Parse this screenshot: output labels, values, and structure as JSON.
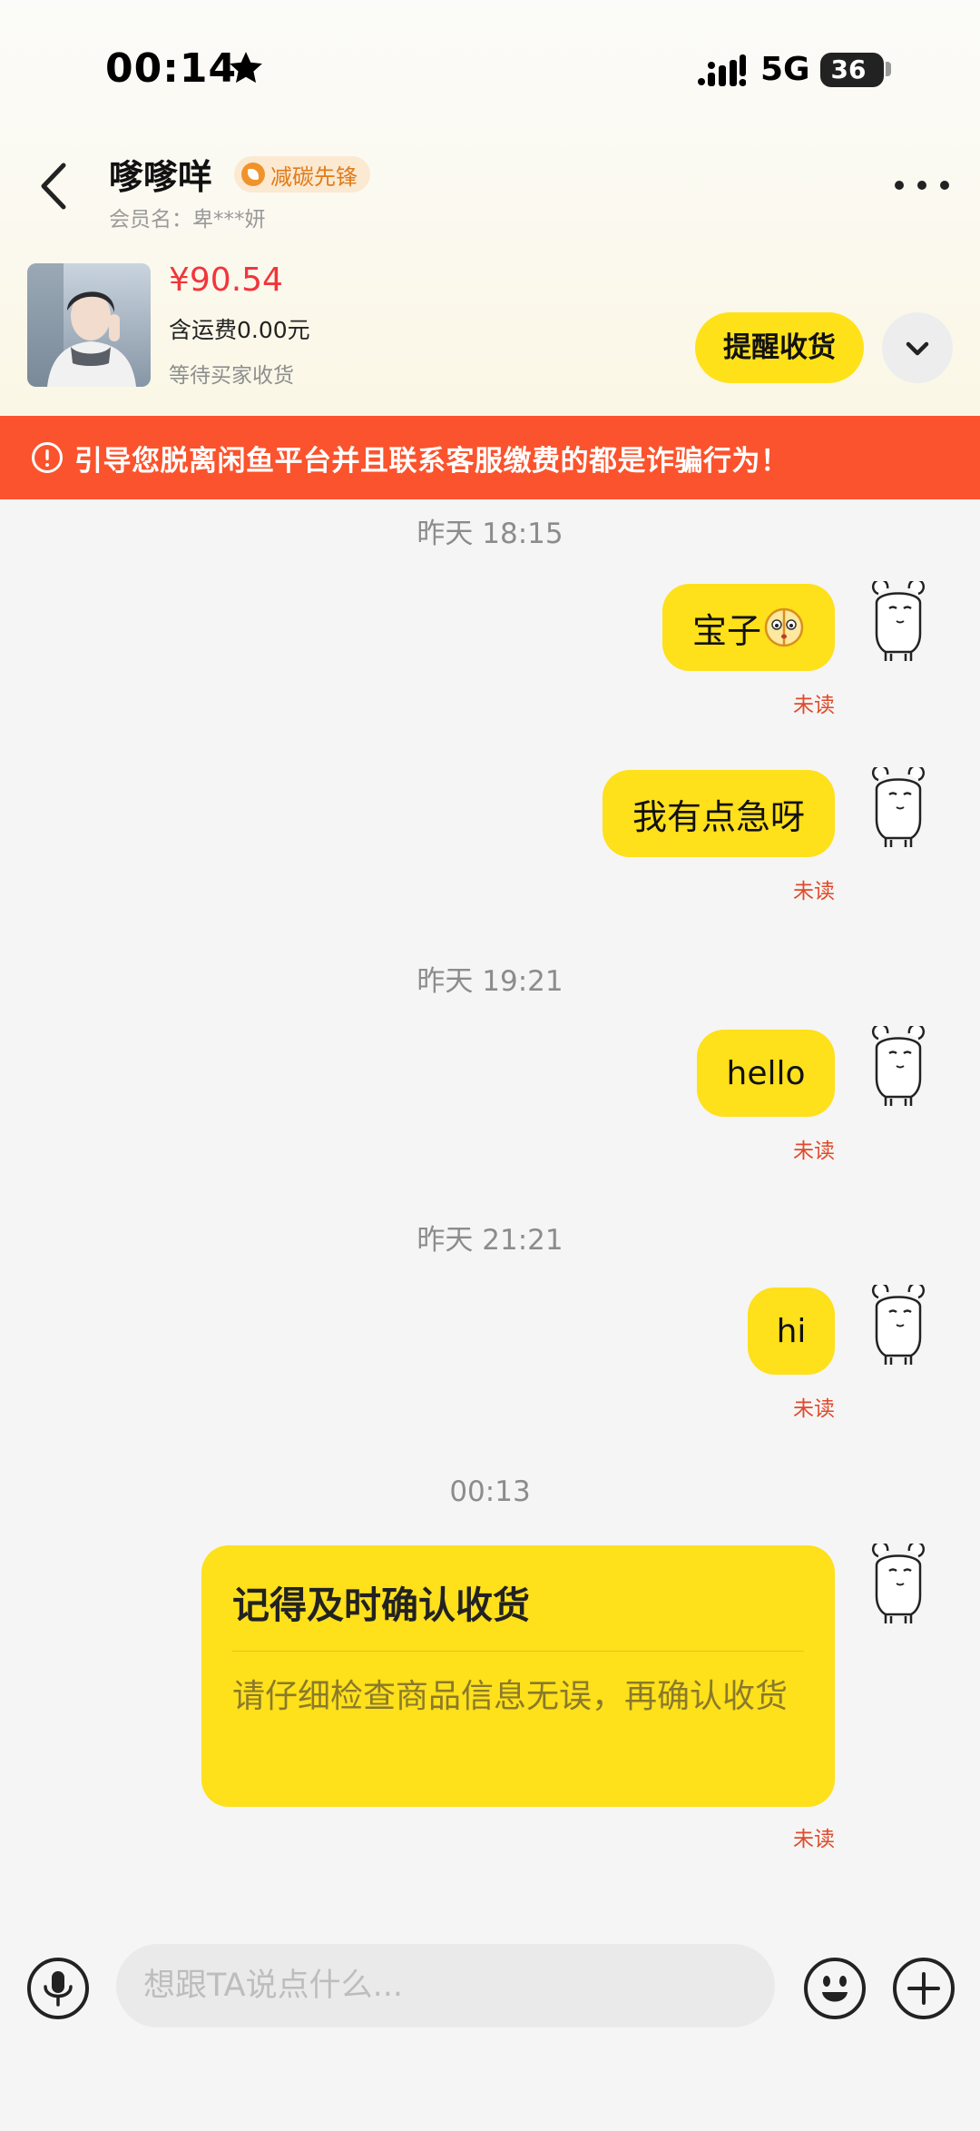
{
  "status_bar": {
    "time": "00:14",
    "network": "5G",
    "battery": "36"
  },
  "header": {
    "name": "嗲嗲咩",
    "badge": "减碳先锋",
    "member_label": "会员名：卑***妍"
  },
  "product": {
    "price": "¥90.54",
    "shipping": "含运费0.00元",
    "status": "等待买家收货",
    "remind_button": "提醒收货"
  },
  "warning": {
    "text": "引导您脱离闲鱼平台并且联系客服缴费的都是诈骗行为！"
  },
  "messages": [
    {
      "time": "昨天 18:15"
    },
    {
      "text": "宝子",
      "status": "未读"
    },
    {
      "text": "我有点急呀",
      "status": "未读"
    },
    {
      "time": "昨天 19:21"
    },
    {
      "text": "hello",
      "status": "未读"
    },
    {
      "time": "昨天 21:21"
    },
    {
      "text": "hi",
      "status": "未读"
    },
    {
      "time": "00:13"
    },
    {
      "card_title": "记得及时确认收货",
      "card_body": "请仔细检查商品信息无误，再确认收货",
      "status": "未读"
    }
  ],
  "input": {
    "placeholder": "想跟TA说点什么..."
  },
  "icons": {
    "back": "chevron-left-icon",
    "more": "more-dots-icon",
    "expand": "chevron-down-icon",
    "warning": "alert-circle-icon",
    "mic": "microphone-icon",
    "emoji": "emoji-icon",
    "plus": "plus-icon"
  },
  "colors": {
    "accent_yellow": "#fee01b",
    "warning_bg": "#fb532d",
    "price_red": "#f2353b",
    "unread_red": "#e04a2a"
  }
}
